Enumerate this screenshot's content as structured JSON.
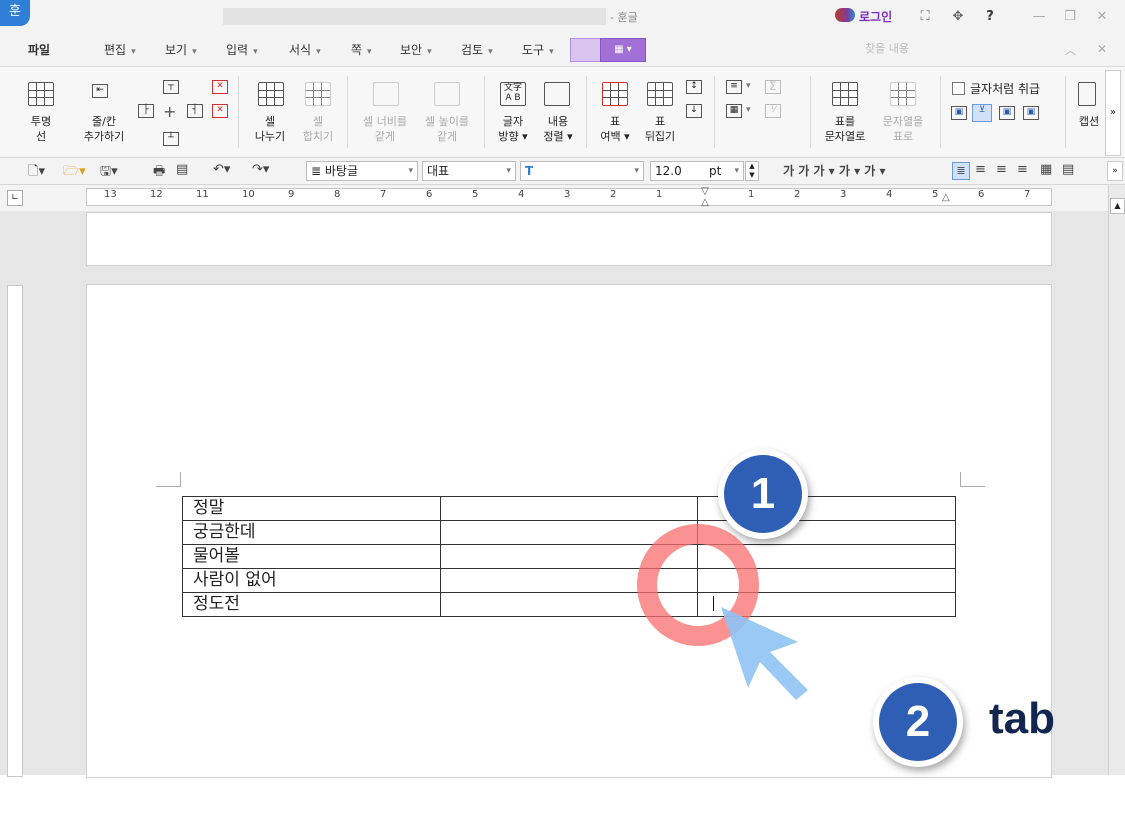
{
  "app": {
    "logo_glyph": "훈",
    "title_suffix": "- 훈글",
    "login_label": "로그인",
    "window_buttons": [
      "⛶",
      "✥",
      "?",
      "—",
      "❐",
      "✕"
    ]
  },
  "menu": {
    "items": [
      {
        "label": "파일",
        "caret": ""
      },
      {
        "label": "편집",
        "caret": "▾"
      },
      {
        "label": "보기",
        "caret": "▾"
      },
      {
        "label": "입력",
        "caret": "▾"
      },
      {
        "label": "서식",
        "caret": "▾"
      },
      {
        "label": "쪽",
        "caret": "▾"
      },
      {
        "label": "보안",
        "caret": "▾"
      },
      {
        "label": "검토",
        "caret": "▾"
      },
      {
        "label": "도구",
        "caret": "▾"
      }
    ],
    "search_placeholder": "찾을 내용",
    "mode_b_label": "▦ ▾"
  },
  "ribbon": {
    "transparent_line": "투명\n선",
    "add_row_col": "줄/칸\n추가하기",
    "split_cell": "셀\n나누기",
    "merge_cell": "셀\n합치기",
    "equal_width": "셀 너비를\n같게",
    "equal_height": "셀 높이를\n같게",
    "text_direction": "글자\n방향 ▾",
    "content_align": "내용\n정렬 ▾",
    "table_margin": "표\n여백 ▾",
    "flip_table": "표\n뒤집기",
    "table_to_text": "표를\n문자열로",
    "text_to_table": "문자열을\n표로",
    "treat_as_char": "글자처럼 취급",
    "caption": "캡션"
  },
  "format_bar": {
    "style_value": "바탕글",
    "font_class_value": "대표",
    "font_value": "",
    "size_value": "12.0",
    "size_unit": "pt",
    "bold_glyphs": "가 가 가 ▾ 가 ▾ 가 ▾"
  },
  "ruler": {
    "numbers": [
      "13",
      "12",
      "11",
      "10",
      "9",
      "8",
      "7",
      "6",
      "5",
      "4",
      "3",
      "2",
      "1",
      "",
      "1",
      "2",
      "3",
      "4",
      "5",
      "6",
      "7"
    ]
  },
  "document_table": {
    "rows": [
      [
        "정말",
        "",
        ""
      ],
      [
        "궁금한데",
        "",
        ""
      ],
      [
        "물어볼",
        "",
        ""
      ],
      [
        "사람이 없어",
        "",
        ""
      ],
      [
        "정도전",
        "",
        ""
      ]
    ]
  },
  "overlay": {
    "badge1": "1",
    "badge2": "2",
    "key_label": "tab"
  },
  "colors": {
    "accent_purple": "#a26fd6",
    "badge_blue": "#2f5fb5",
    "ring_red": "#fa6e6e",
    "cursor_blue": "#8fc3f5"
  }
}
